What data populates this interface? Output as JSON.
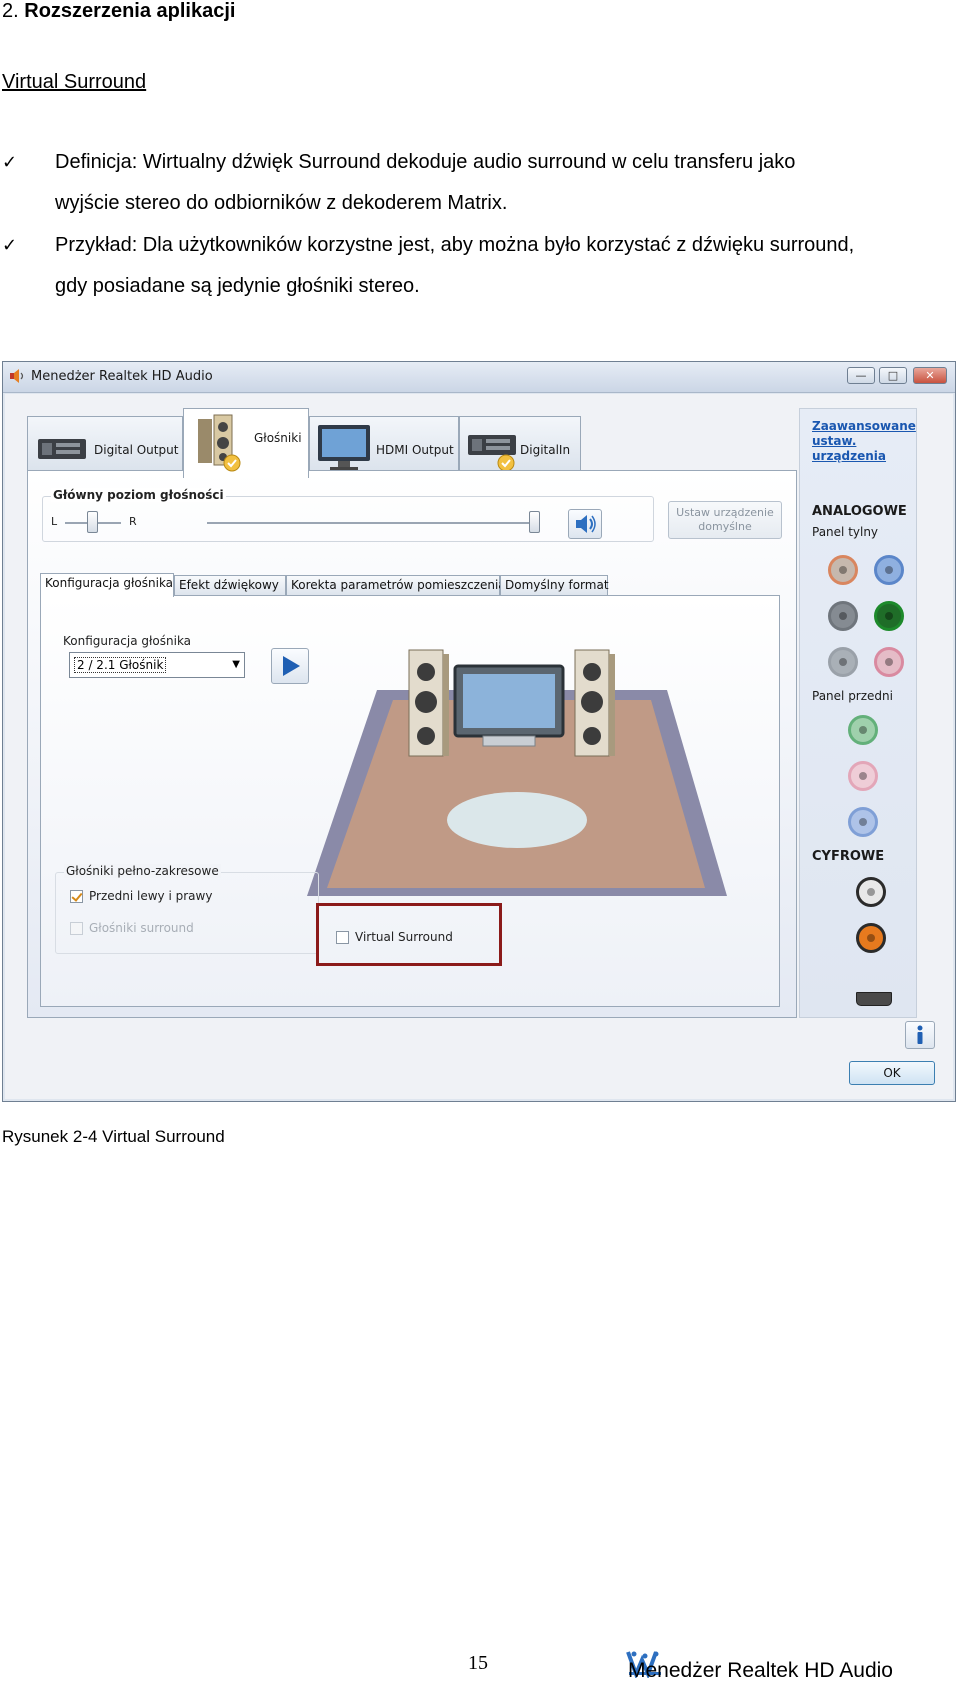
{
  "document": {
    "heading_number": "2.",
    "heading_text": "Rozszerzenia aplikacji",
    "subheading": "Virtual Surround",
    "bullets": [
      {
        "line1": "Definicja: Wirtualny dźwięk Surround dekoduje audio surround w celu transferu jako",
        "line2": "wyjście stereo do odbiorników z dekoderem Matrix."
      },
      {
        "line1": "Przykład: Dla użytkowników korzystne jest, aby można było korzystać z dźwięku surround,",
        "line2": "gdy posiadane są jedynie głośniki stereo."
      }
    ],
    "check_glyph": "✓",
    "caption": "Rysunek 2-4 Virtual Surround",
    "page_number": "15",
    "footer_brand": "Menedżer Realtek HD Audio"
  },
  "dialog": {
    "title": "Menedżer Realtek HD Audio",
    "window_buttons": {
      "minimize": "—",
      "maximize": "□",
      "close": "✕"
    },
    "device_tabs": [
      "Digital Output",
      "Głośniki",
      "HDMI Output",
      "DigitalIn"
    ],
    "active_device_tab": "Głośniki",
    "main_volume": {
      "title": "Główny poziom głośności",
      "left_label": "L",
      "right_label": "R",
      "balance_value": 0.5,
      "volume_value": 1.0
    },
    "set_default_button": {
      "line1": "Ustaw urządzenie",
      "line2": "domyślne"
    },
    "sub_tabs": [
      "Konfiguracja głośnika",
      "Efekt dźwiękowy",
      "Korekta parametrów pomieszczenia",
      "Domyślny format"
    ],
    "active_sub_tab": "Konfiguracja głośnika",
    "speaker_config": {
      "label": "Konfiguracja głośnika",
      "selected": "2 / 2.1 Głośnik"
    },
    "full_range": {
      "title": "Głośniki pełno-zakresowe",
      "front": {
        "label": "Przedni lewy i prawy",
        "checked": true,
        "enabled": true
      },
      "surround": {
        "label": "Głośniki surround",
        "checked": false,
        "enabled": false
      }
    },
    "virtual_surround": {
      "label": "Virtual Surround",
      "checked": false
    },
    "right_panel": {
      "advanced_link_line1": "Zaawansowane",
      "advanced_link_line2": "ustaw. urządzenia",
      "analog_heading": "ANALOGOWE",
      "rear_panel_label": "Panel tylny",
      "front_panel_label": "Panel przedni",
      "digital_heading": "CYFROWE"
    },
    "ok_button": "OK",
    "colors": {
      "highlight_box": "#8b1a1a",
      "link": "#1a57b0",
      "jack_orange": "#d9865f",
      "jack_blue": "#5b86c9",
      "jack_gray": "#6f757c",
      "jack_green": "#1d8a2b",
      "jack_pink": "#d98aa0",
      "jack_light_green": "#63b07a",
      "jack_light_pink": "#e3a6b8",
      "jack_light_blue": "#7f9fd6"
    }
  }
}
